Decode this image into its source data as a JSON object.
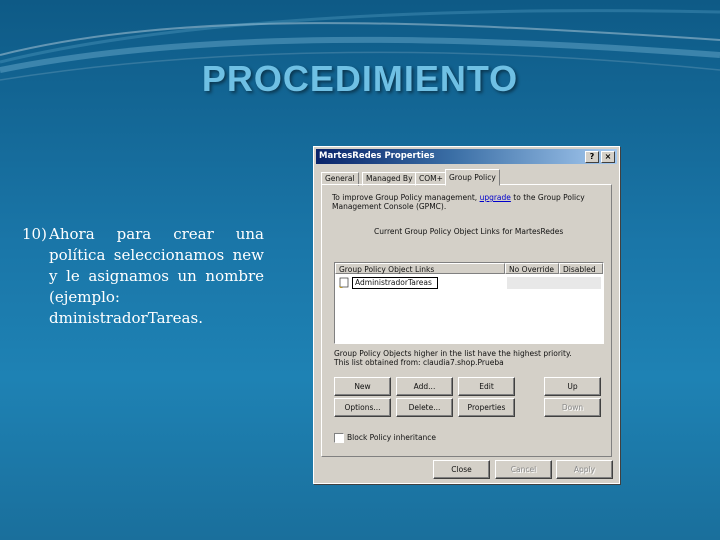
{
  "slide": {
    "title": "PROCEDIMIENTO",
    "step_number": "10)",
    "step_text": "Ahora para crear una política seleccionamos new y le asignamos un nombre (ejemplo: dministradorTareas."
  },
  "dialog": {
    "title": "MartesRedes Properties",
    "tabs": [
      "General",
      "Managed By",
      "COM+",
      "Group Policy"
    ],
    "active_tab": "Group Policy",
    "intro_line1_a": "To improve Group Policy management, ",
    "intro_line1_link": "upgrade",
    "intro_line1_b": " to the Group Policy",
    "intro_line2": "Management Console (GPMC).",
    "current_links": "Current Group Policy Object Links for MartesRedes",
    "columns": [
      "Group Policy Object Links",
      "No Override",
      "Disabled"
    ],
    "new_object_name": "AdministradorTareas",
    "info_line1": "Group Policy Objects higher in the list have the highest priority.",
    "info_line2": "This list obtained from: claudia7.shop.Prueba",
    "buttons_row1": [
      "New",
      "Add...",
      "Edit",
      "Up"
    ],
    "buttons_row2": [
      "Options...",
      "Delete...",
      "Properties",
      "Down"
    ],
    "block_inheritance": "Block Policy inheritance",
    "footer_buttons": [
      "Close",
      "Cancel",
      "Apply"
    ],
    "title_buttons": [
      "?",
      "×"
    ]
  },
  "colors": {
    "background": "#1a76a8",
    "title": "#6fc0e4",
    "titlebar_start": "#0a246a",
    "titlebar_end": "#a6caf0"
  }
}
